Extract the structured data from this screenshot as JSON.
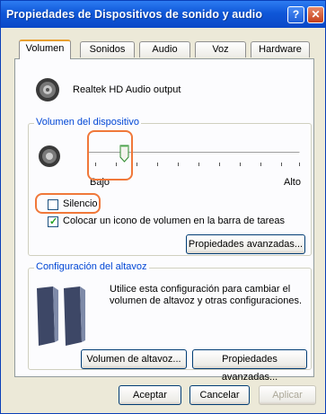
{
  "window": {
    "title": "Propiedades de Dispositivos de sonido y audio",
    "help_button": "?",
    "close_button": "✕"
  },
  "tabs": [
    {
      "label": "Volumen",
      "active": true
    },
    {
      "label": "Sonidos",
      "active": false
    },
    {
      "label": "Audio",
      "active": false
    },
    {
      "label": "Voz",
      "active": false
    },
    {
      "label": "Hardware",
      "active": false
    }
  ],
  "device": {
    "name": "Realtek HD Audio output",
    "icon": "speaker-icon"
  },
  "volume_group": {
    "label": "Volumen del dispositivo",
    "slider_min_label": "Bajo",
    "slider_max_label": "Alto",
    "slider_level": 0.15,
    "mute_label": "Silencio",
    "mute_checked": false,
    "taskbar_label": "Colocar un icono de volumen en la barra de tareas",
    "taskbar_checked": true,
    "advanced_button": "Propiedades avanzadas..."
  },
  "speaker_group": {
    "label": "Configuración del altavoz",
    "description": "Utilice esta configuración para cambiar el volumen de altavoz y otras configuraciones.",
    "volume_button": "Volumen de altavoz...",
    "advanced_button": "Propiedades avanzadas..."
  },
  "footer": {
    "accept": "Aceptar",
    "cancel": "Cancelar",
    "apply": "Aplicar"
  },
  "colors": {
    "titlebar": "#0f57d8",
    "highlight": "#f0783a",
    "group_label": "#0046d5"
  }
}
